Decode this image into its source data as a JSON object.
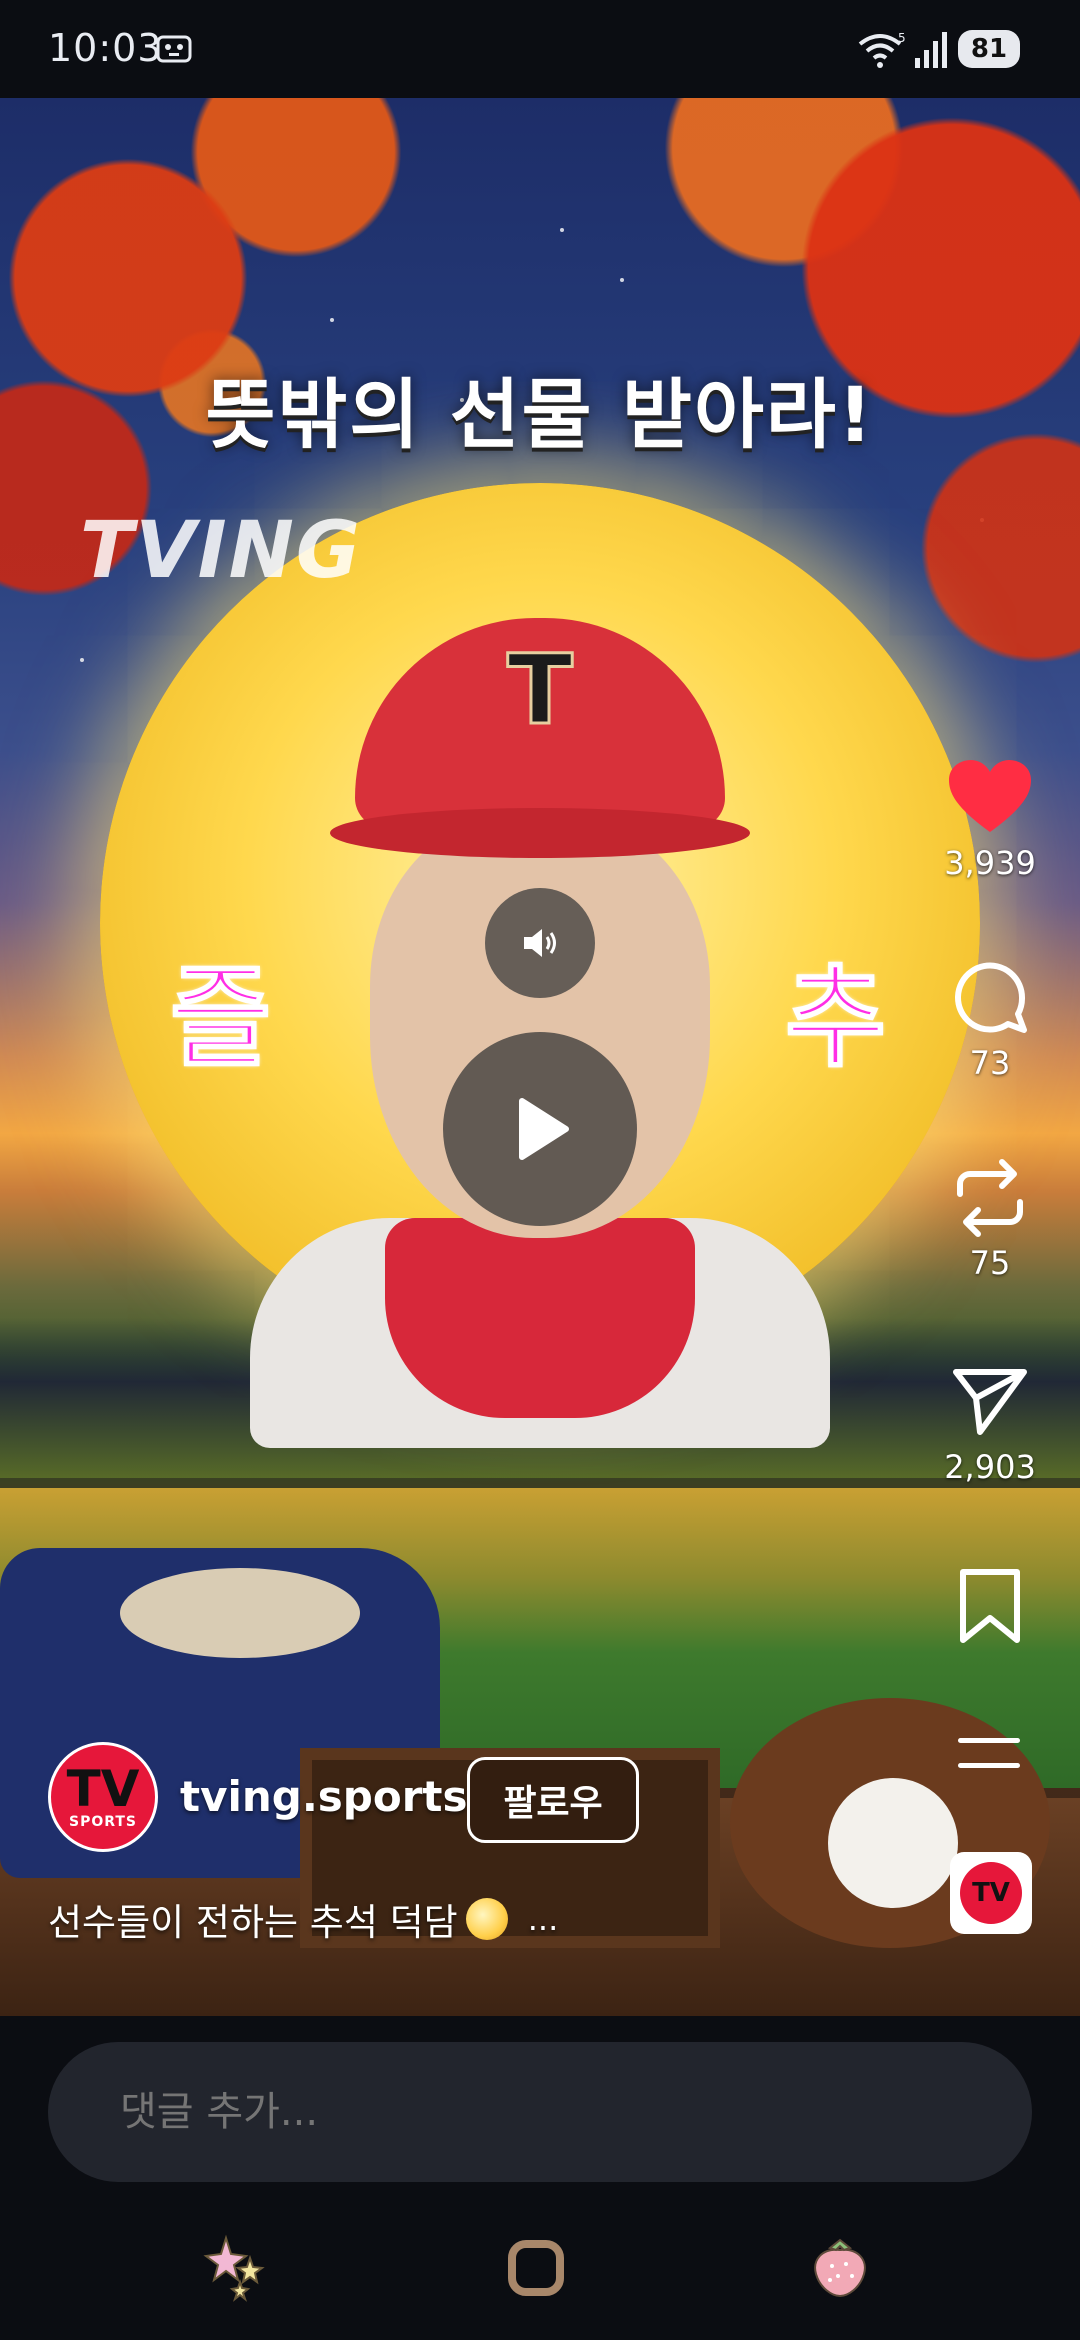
{
  "status_bar": {
    "time": "10:03",
    "battery": "81"
  },
  "video": {
    "headline": "뜻밖의 선물 받아라!",
    "logo": "TVING",
    "left_deco": "즐",
    "right_deco": "추",
    "cap_letter": "T"
  },
  "actions": {
    "likes": "3,939",
    "comments": "73",
    "reposts": "75",
    "shares": "2,903"
  },
  "account": {
    "username": "tving.sports",
    "follow_label": "팔로우",
    "avatar_text": "TV",
    "avatar_sub": "SPORTS"
  },
  "caption": {
    "text": "선수들이 전하는 추석 덕담",
    "more": "..."
  },
  "comment_bar": {
    "placeholder": "댓글 추가..."
  },
  "colors": {
    "like": "#ff2d43",
    "accent": "#e6173a",
    "deco_text": "#ff2ee6"
  }
}
